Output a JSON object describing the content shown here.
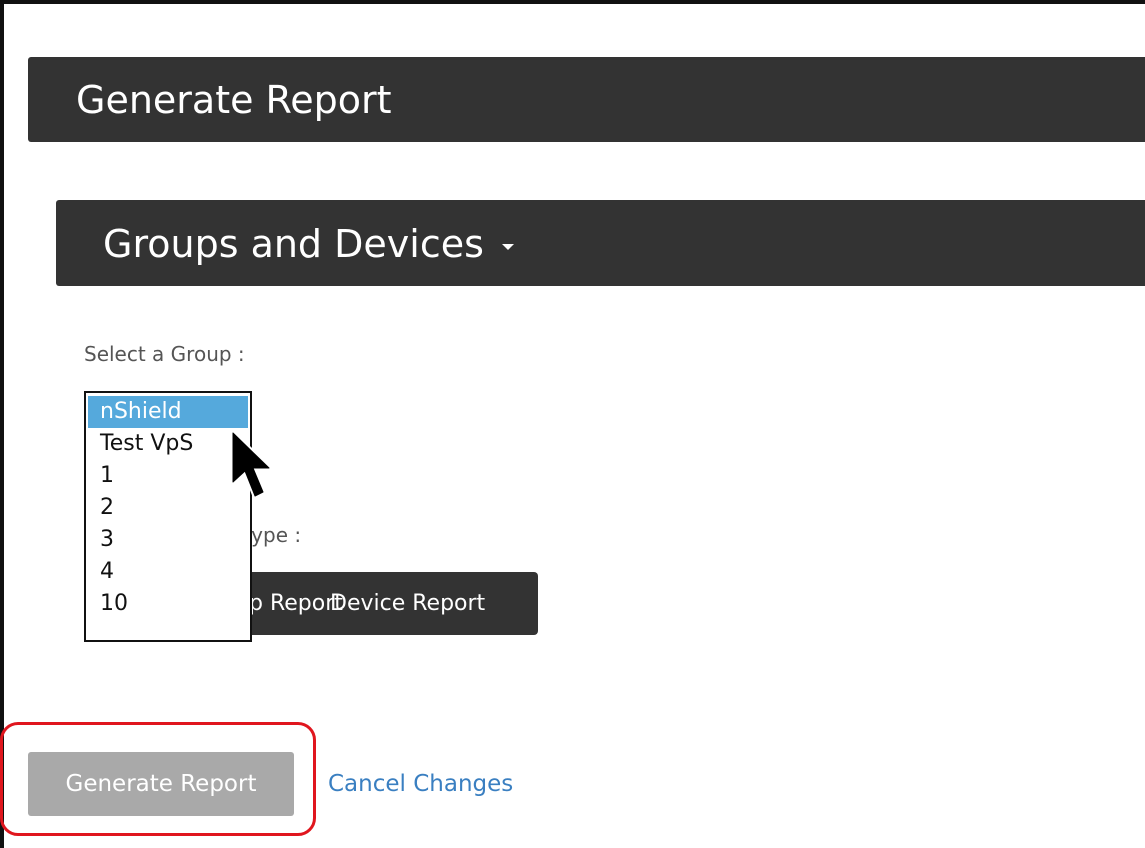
{
  "header": {
    "title": "Generate Report"
  },
  "section": {
    "title": "Groups and Devices"
  },
  "group_select": {
    "label": "Select a Group :",
    "options": [
      "nShield",
      "Test VpS",
      "1",
      "2",
      "3",
      "4",
      "10"
    ],
    "selected": "nShield"
  },
  "report_type": {
    "label": "Select a Report type :",
    "buttons": [
      "Group Report",
      "Device Report"
    ]
  },
  "actions": {
    "generate_label": "Generate Report",
    "cancel_label": "Cancel Changes"
  },
  "colors": {
    "header_bg": "#333333",
    "selected_option": "#55a9dc",
    "disabled_button": "#a9a9a9",
    "link": "#3a7fc1",
    "highlight": "#e0161e"
  }
}
